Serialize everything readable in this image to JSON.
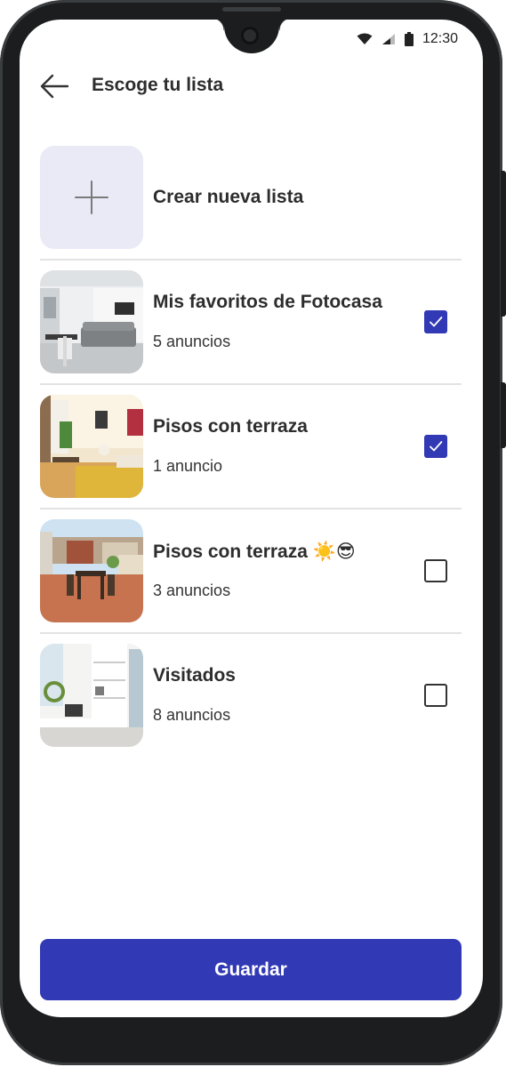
{
  "status_bar": {
    "time": "12:30"
  },
  "header": {
    "title": "Escoge tu lista"
  },
  "create": {
    "label": "Crear nueva lista"
  },
  "lists": [
    {
      "title": "Mis favoritos de Fotocasa",
      "count": "5 anuncios",
      "checked": true
    },
    {
      "title": "Pisos con terraza",
      "count": "1 anuncio",
      "checked": true
    },
    {
      "title": "Pisos con terraza ☀️😎",
      "count": "3 anuncios",
      "checked": false
    },
    {
      "title": "Visitados",
      "count": "8 anuncios",
      "checked": false
    }
  ],
  "footer": {
    "save_label": "Guardar"
  },
  "colors": {
    "accent": "#3139b5",
    "create_tile": "#e9eaf6",
    "frame": "#1b1d1e"
  },
  "icons": [
    "back-arrow-icon",
    "plus-icon",
    "wifi-icon",
    "signal-icon",
    "battery-icon",
    "check-icon"
  ]
}
